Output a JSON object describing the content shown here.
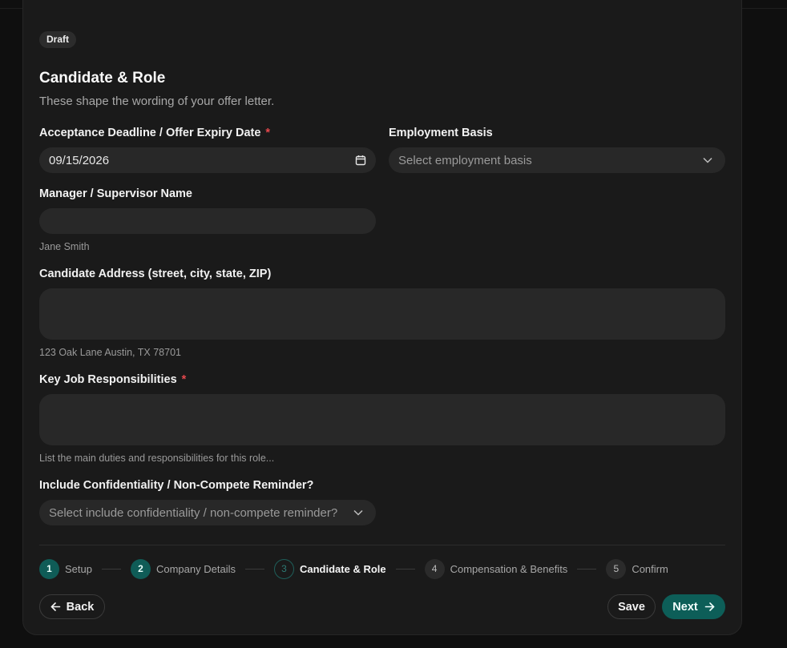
{
  "form": {
    "status_badge": "Draft",
    "title": "Candidate & Role",
    "subtitle": "These shape the wording of your offer letter.",
    "acceptance_deadline": {
      "label": "Acceptance Deadline / Offer Expiry Date",
      "required_mark": "*",
      "value": "09/15/2026"
    },
    "employment_basis": {
      "label": "Employment Basis",
      "placeholder": "Select employment basis"
    },
    "manager_name": {
      "label": "Manager / Supervisor Name",
      "value": "",
      "hint": "Jane Smith"
    },
    "candidate_address": {
      "label": "Candidate Address (street, city, state, ZIP)",
      "value": "",
      "hint": "123 Oak Lane Austin, TX 78701"
    },
    "responsibilities": {
      "label": "Key Job Responsibilities",
      "required_mark": "*",
      "value": "",
      "hint": "List the main duties and responsibilities for this role..."
    },
    "confidentiality": {
      "label": "Include Confidentiality / Non-Compete Reminder?",
      "placeholder": "Select include confidentiality / non-compete reminder?"
    }
  },
  "stepper": {
    "steps": [
      {
        "num": "1",
        "label": "Setup",
        "state": "done"
      },
      {
        "num": "2",
        "label": "Company Details",
        "state": "done"
      },
      {
        "num": "3",
        "label": "Candidate & Role",
        "state": "active"
      },
      {
        "num": "4",
        "label": "Compensation & Benefits",
        "state": "todo"
      },
      {
        "num": "5",
        "label": "Confirm",
        "state": "todo"
      }
    ]
  },
  "actions": {
    "back_label": "Back",
    "save_label": "Save",
    "next_label": "Next"
  },
  "icons": {
    "back": "arrow-left-icon",
    "next": "arrow-right-icon",
    "select": "chevron-down-icon",
    "date": "calendar-icon"
  },
  "colors": {
    "accent": "#0d5e58",
    "required": "#e5484d",
    "background": "#1a1a1a",
    "field": "#282828"
  }
}
